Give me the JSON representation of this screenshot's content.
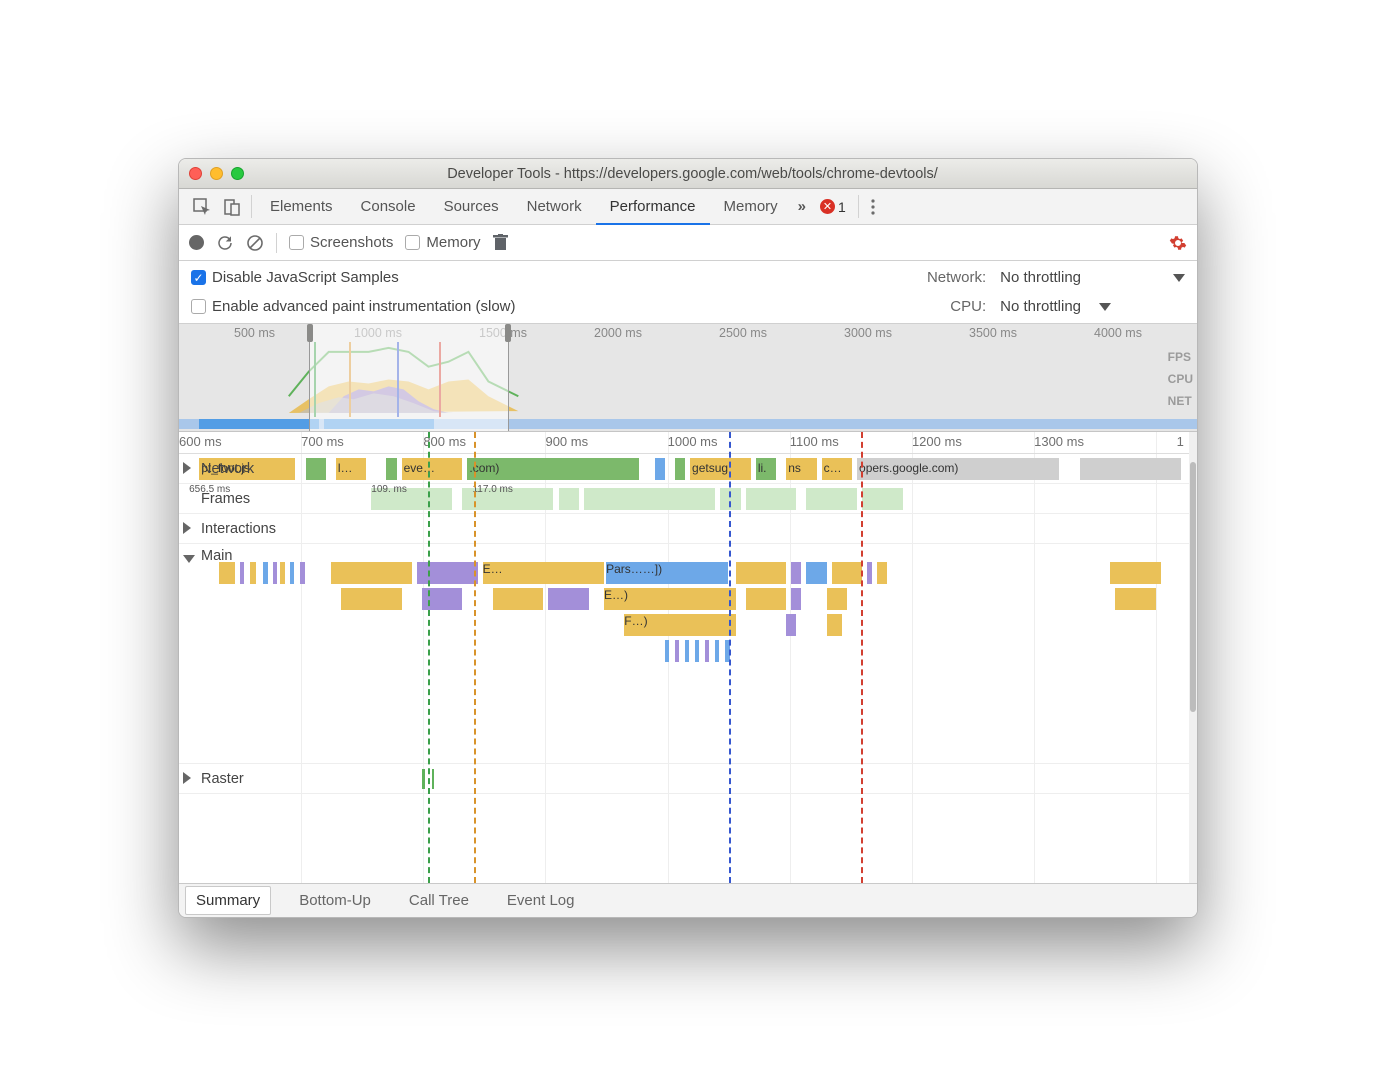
{
  "window": {
    "title": "Developer Tools - https://developers.google.com/web/tools/chrome-devtools/"
  },
  "tabs": {
    "items": [
      "Elements",
      "Console",
      "Sources",
      "Network",
      "Performance",
      "Memory"
    ],
    "active": "Performance",
    "overflow_glyph": "»",
    "error_count": "1"
  },
  "toolbar": {
    "screenshots_label": "Screenshots",
    "memory_label": "Memory"
  },
  "settings": {
    "disable_js_label": "Disable JavaScript Samples",
    "disable_js_checked": true,
    "paint_label": "Enable advanced paint instrumentation (slow)",
    "network_label": "Network:",
    "network_value": "No throttling",
    "cpu_label": "CPU:",
    "cpu_value": "No throttling"
  },
  "overview": {
    "ticks": [
      "500 ms",
      "1000 ms",
      "1500 ms",
      "2000 ms",
      "2500 ms",
      "3000 ms",
      "3500 ms",
      "4000 ms"
    ],
    "right_labels": [
      "FPS",
      "CPU",
      "NET"
    ]
  },
  "ruler": {
    "ticks": [
      "600 ms",
      "700 ms",
      "800 ms",
      "900 ms",
      "1000 ms",
      "1100 ms",
      "1200 ms",
      "1300 ms",
      "1"
    ]
  },
  "tracks": {
    "network_label": "Network",
    "frames_label": "Frames",
    "interactions_label": "Interactions",
    "main_label": "Main",
    "raster_label": "Raster",
    "network_items": {
      "a": "pt_foot.js",
      "b": "l…",
      "c": "eve…",
      "d": ".com)",
      "e": "getsug",
      "f": "li.",
      "g": "ns",
      "h": "c…",
      "i": "opers.google.com)"
    },
    "frame_times": {
      "overall": "656.5 ms",
      "a": "109.  ms",
      "b": "117.0 ms"
    },
    "main_items": {
      "e": "E…",
      "parse": "Pars……])",
      "e2": "E…)",
      "f": "F…)"
    }
  },
  "bottom_tabs": {
    "items": [
      "Summary",
      "Bottom-Up",
      "Call Tree",
      "Event Log"
    ],
    "active": "Summary"
  }
}
